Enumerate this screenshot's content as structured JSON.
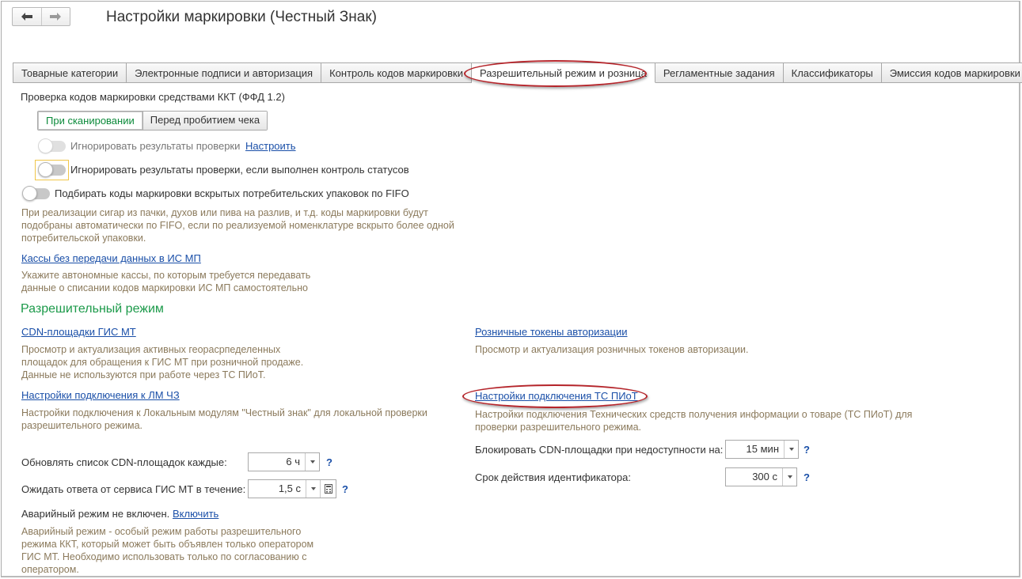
{
  "window": {
    "title": "Настройки маркировки (Честный Знак)"
  },
  "tabs": [
    {
      "label": "Товарные категории"
    },
    {
      "label": "Электронные подписи и авторизация"
    },
    {
      "label": "Контроль кодов маркировки"
    },
    {
      "label": "Разрешительный режим и розница",
      "active": true
    },
    {
      "label": "Регламентные задания"
    },
    {
      "label": "Классификаторы"
    },
    {
      "label": "Эмиссия кодов маркировки"
    }
  ],
  "kkt_check": {
    "heading": "Проверка кодов маркировки средствами ККТ (ФФД 1.2)",
    "mode_options": [
      "При сканировании",
      "Перед пробитием чека"
    ],
    "selected_mode": "При сканировании",
    "ignore_results": {
      "label": "Игнорировать результаты проверки",
      "link": "Настроить",
      "enabled": false
    },
    "ignore_if_status": {
      "label": "Игнорировать результаты проверки, если выполнен контроль статусов",
      "enabled": false
    },
    "fifo": {
      "label": "Подбирать коды маркировки вскрытых потребительских упаковок по FIFO",
      "enabled": false
    },
    "fifo_note": [
      "При реализации сигар из пачки, духов или пива на разлив, и т.д. коды маркировки будут",
      "подобраны автоматически по FIFO, если по реализуемой номенклатуре вскрыто более одной",
      "потребительской упаковки."
    ],
    "offline_link": "Кассы без передачи данных в ИС МП",
    "offline_note": [
      "Укажите автономные кассы, по которым требуется передавать",
      "данные о списании кодов маркировки ИС МП самостоятельно"
    ]
  },
  "permit_mode": {
    "heading": "Разрешительный режим",
    "cdn_link": "CDN-площадки ГИС МТ",
    "cdn_note": [
      "Просмотр и актуализация активных георасрпеделенных",
      "площадок для обращения к ГИС МТ при розничной продаже.",
      "Данные не используются при работе через ТС ПИоТ."
    ],
    "lm_link": "Настройки подключения к ЛМ ЧЗ",
    "lm_note": [
      "Настройки подключения к Локальным модулям \"Честный знак\" для локальной проверки",
      "разрешительного режима."
    ],
    "tokens_link": "Розничные токены авторизации",
    "tokens_note": "Просмотр и актуализация розничных токенов авторизации.",
    "piot_link": "Настройки подключения ТС ПИоТ",
    "piot_note": [
      "Настройки подключения Технических средств получения информации о товаре (ТС ПИоТ) для",
      "проверки разрешительного режима."
    ],
    "refresh_label": "Обновлять список CDN-площадок каждые:",
    "refresh_value": "6 ч",
    "wait_label": "Ожидать ответа от сервиса ГИС МТ в течение:",
    "wait_value": "1,5 с",
    "block_label": "Блокировать CDN-площадки при недоступности на:",
    "block_value": "15 мин",
    "id_label": "Срок действия идентификатора:",
    "id_value": "300 с",
    "help": "?",
    "emergency_status": "Аварийный режим не включен.",
    "emergency_link": "Включить",
    "emergency_note": [
      "Аварийный режим - особый режим работы разрешительного",
      "режима ККТ, который может быть объявлен только оператором",
      "ГИС МТ. Необходимо использовать только по согласованию с",
      "оператором."
    ]
  },
  "colors": {
    "link": "#1a4fa8",
    "section": "#1c9a4a",
    "note": "#8b7a5c",
    "highlight_oval": "#b5242a",
    "focus": "#f0c64a"
  }
}
